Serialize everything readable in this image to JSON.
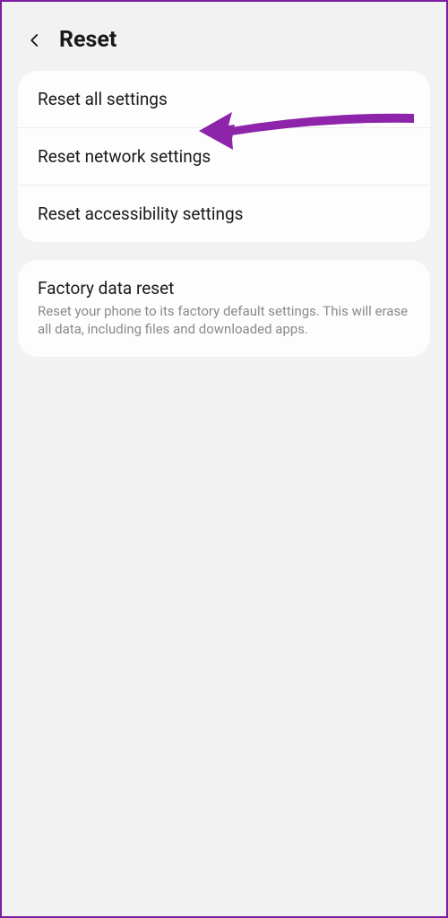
{
  "header": {
    "title": "Reset"
  },
  "section1": {
    "items": [
      {
        "label": "Reset all settings"
      },
      {
        "label": "Reset network settings"
      },
      {
        "label": "Reset accessibility settings"
      }
    ]
  },
  "section2": {
    "items": [
      {
        "label": "Factory data reset",
        "sub": "Reset your phone to its factory default settings. This will erase all data, including files and downloaded apps."
      }
    ]
  },
  "annotation": {
    "color": "#8e24aa"
  }
}
